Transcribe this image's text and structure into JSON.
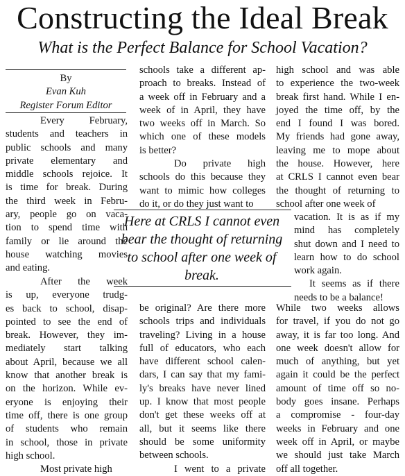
{
  "headline": "Constructing the Ideal Break",
  "subheadline": "What is the Perfect Balance for School Vacation?",
  "byline": {
    "by": "By",
    "author": "Evan Kuh",
    "role": "Register Forum Editor"
  },
  "pull_quote": [
    "Here at CRLS I cannot even",
    "bear the thought of returning",
    "to school after one week of",
    "break."
  ],
  "column1_top": [
    "Every February,",
    "students and teachers in",
    "public schools and many",
    "private elementary and",
    "middle schools rejoice. It",
    "is time for break. During",
    "the third week in Febru-",
    "ary, people go on vaca-",
    "tion to spend time with",
    "family or lie around the",
    "house watching movies",
    "and eating."
  ],
  "column1_bottom": [
    "After the week",
    "is up, everyone trudg-",
    "es back to school, disap-",
    "pointed to see the end of",
    "break. However, they im-",
    "mediately start talking",
    "about April, because we all",
    "know that another break is",
    "on the horizon. While ev-",
    "eryone is enjoying their",
    "time off, there is one group",
    "of students who remain",
    "in school, those in private",
    "high school.",
    "Most private high"
  ],
  "column2_top": [
    "schools take a different ap-",
    "proach to breaks. Instead of",
    "a week off in February and a",
    "week of in April, they have",
    "two weeks off in March. So",
    "which one of these models",
    "is better?",
    "Do private high",
    "schools do this because they",
    "want to mimic how colleges",
    "do it, or do they just want to"
  ],
  "column2_bottom": [
    "be original? Are there more",
    "schools trips and individuals",
    "traveling? Living in a house",
    "full of educators, who each",
    "have different school calen-",
    "dars, I can say that my fami-",
    "ly's breaks have never lined",
    "up. I know that most people",
    "don't get these weeks off at",
    "all, but it seems like there",
    "should be some uniformity",
    "between schools.",
    "I went to a private"
  ],
  "column3_top": [
    "high school and was able",
    "to experience the two-week",
    "break first hand. While I en-",
    "joyed the time off, by the",
    "end I found I was bored.",
    "My friends had gone away,",
    "leaving me to mope about",
    "the house. However, here",
    "at CRLS I cannot even bear",
    "the thought of returning to",
    "school after one week of"
  ],
  "column3_mid": [
    "vacation. It is as if my",
    "mind has completely",
    "shut down and I need to",
    "learn how to do school",
    "work again.",
    "It seems as if there",
    "needs to be a balance!"
  ],
  "column3_bottom": [
    "While two weeks allows",
    "for travel, if you do not go",
    "away, it is far too long. And",
    "one week doesn't allow for",
    "much of anything, but yet",
    "again it could be the perfect",
    "amount of time off so no-",
    "body goes insane. Perhaps",
    "a compromise - four-day",
    "weeks in February and one",
    "week off in April, or maybe",
    "we should just take March",
    "off all together."
  ]
}
